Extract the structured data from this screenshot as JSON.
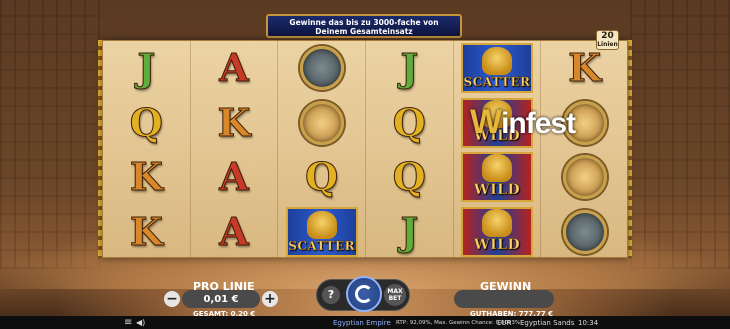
{
  "banner": {
    "line1": "Gewinne das bis zu 3000-fache von",
    "line2": "Deinem Gesamteinsatz"
  },
  "lines_badge": {
    "number": "20",
    "text": "Linien"
  },
  "watermark": {
    "w": "W",
    "rest": "infest"
  },
  "reels": [
    [
      {
        "type": "letter",
        "value": "J"
      },
      {
        "type": "letter",
        "value": "Q"
      },
      {
        "type": "letter",
        "value": "K"
      },
      {
        "type": "letter",
        "value": "K"
      }
    ],
    [
      {
        "type": "letter",
        "value": "A"
      },
      {
        "type": "letter",
        "value": "K"
      },
      {
        "type": "letter",
        "value": "A"
      },
      {
        "type": "letter",
        "value": "A"
      }
    ],
    [
      {
        "type": "medal",
        "value": "anubis"
      },
      {
        "type": "medal",
        "value": "sphinx"
      },
      {
        "type": "letter",
        "value": "Q"
      },
      {
        "type": "plaque",
        "value": "SCATTER"
      }
    ],
    [
      {
        "type": "letter",
        "value": "J"
      },
      {
        "type": "letter",
        "value": "Q"
      },
      {
        "type": "letter",
        "value": "Q"
      },
      {
        "type": "letter",
        "value": "J"
      }
    ],
    [
      {
        "type": "plaque",
        "value": "SCATTER"
      },
      {
        "type": "plaque",
        "value": "WILD"
      },
      {
        "type": "plaque",
        "value": "WILD"
      },
      {
        "type": "plaque",
        "value": "WILD"
      }
    ],
    [
      {
        "type": "letter",
        "value": "K"
      },
      {
        "type": "medal",
        "value": "sphinx"
      },
      {
        "type": "medal",
        "value": "sphinx"
      },
      {
        "type": "medal",
        "value": "anubis"
      }
    ]
  ],
  "controls": {
    "pro_linie_label": "PRO LINIE",
    "bet_value": "0,01 €",
    "minus": "−",
    "plus": "+",
    "gesamt": "GESAMT: 0,20 €",
    "help": "?",
    "maxbet_line1": "MAX",
    "maxbet_line2": "BET",
    "gewinn_label": "GEWINN",
    "gewinn_value": "",
    "guthaben": "GUTHABEN: 777,77 €"
  },
  "bottombar": {
    "menu_icon": "≡",
    "sound_icon": "◀)",
    "game_logo": "Egyptian Empire",
    "rtp": "RTP: 92,09%, Max. Gewinn Chance: 0,0003%",
    "currency": "EUR",
    "game_name": "Egyptian Sands",
    "time": "10:34"
  },
  "colors": {
    "accent": "#e8b63a",
    "blue_plaque": "#2c5ad0",
    "wild_red": "#b5231f"
  }
}
